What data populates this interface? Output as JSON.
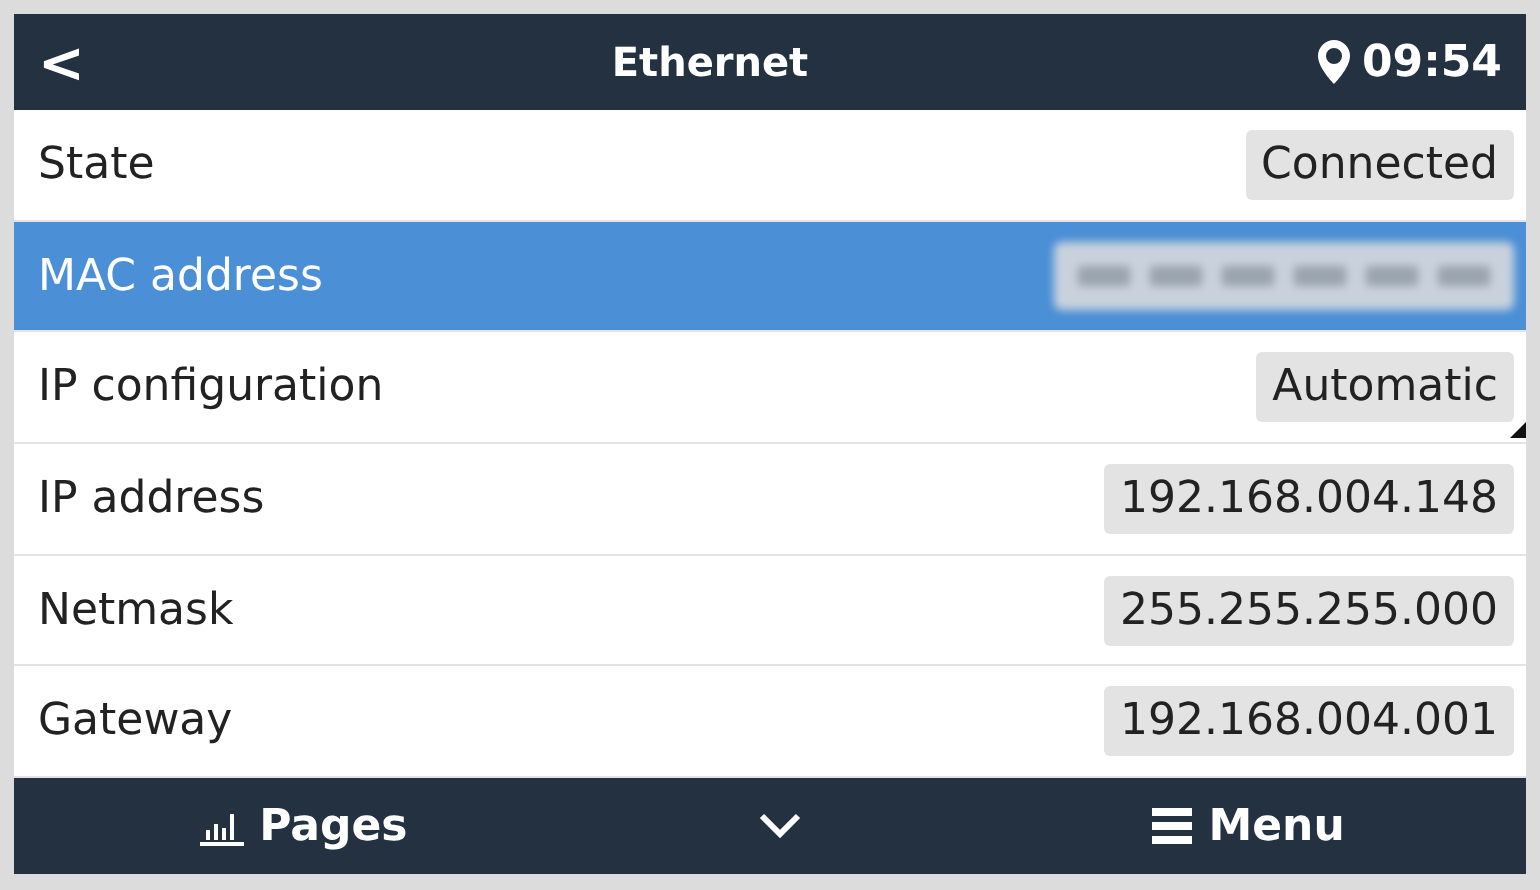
{
  "header": {
    "back": "<",
    "title": "Ethernet",
    "time": "09:54"
  },
  "rows": [
    {
      "label": "State",
      "kind": "value",
      "value": "Connected",
      "selected": false,
      "editable": false
    },
    {
      "label": "MAC address",
      "kind": "redacted",
      "selected": true,
      "editable": false
    },
    {
      "label": "IP configuration",
      "kind": "value",
      "value": "Automatic",
      "selected": false,
      "editable": true
    },
    {
      "label": "IP address",
      "kind": "value",
      "value": "192.168.004.148",
      "selected": false,
      "editable": false
    },
    {
      "label": "Netmask",
      "kind": "value",
      "value": "255.255.255.000",
      "selected": false,
      "editable": false
    },
    {
      "label": "Gateway",
      "kind": "value",
      "value": "192.168.004.001",
      "selected": false,
      "editable": false
    }
  ],
  "footer": {
    "pages": "Pages",
    "menu": "Menu"
  }
}
